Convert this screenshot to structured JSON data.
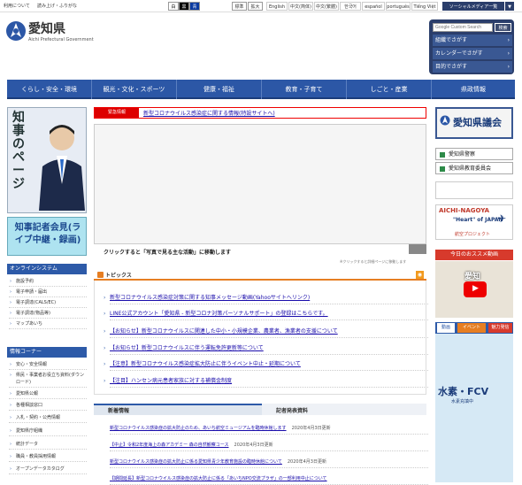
{
  "topbar": {
    "links": [
      "利用について",
      "読み上げ・ふりがな"
    ],
    "contrast": [
      "白",
      "黒",
      "青"
    ],
    "size": [
      "標準",
      "拡大"
    ],
    "langs": [
      "English",
      "中文(简体)",
      "中文(繁體)",
      "한국어",
      "español",
      "português",
      "Tiếng Việt"
    ],
    "sns": "ソーシャルメディア一覧"
  },
  "header": {
    "title": "愛知県",
    "subtitle": "Aichi Prefectural Government"
  },
  "search": {
    "placeholder": "Google Custom Search",
    "button": "検索",
    "items": [
      "組織でさがす",
      "カレンダーでさがす",
      "目的でさがす"
    ]
  },
  "nav": [
    "くらし・安全・環境",
    "観光・文化・スポーツ",
    "健康・福祉",
    "教育・子育て",
    "しごと・産業",
    "県政情報"
  ],
  "left": {
    "governor": "知事のページ",
    "press": "知事記者会見(ライブ中継・録画)",
    "online_head": "オンラインシステム",
    "online": [
      "施設予約",
      "電子申請・届出",
      "電子調達(CALS/EC)",
      "電子調達(物品等)",
      "マップあいち"
    ],
    "info_head": "情報コーナー",
    "info": [
      "安心・安全情報",
      "県民・事業者お役立ち資料(ダウンロード)",
      "愛知県公報",
      "各種相談窓口",
      "入札・契約・公売情報",
      "愛知県庁組織",
      "統計データ",
      "職員・教員採用情報",
      "オープンデータカタログ"
    ]
  },
  "emergency": {
    "label": "緊急情報",
    "text": "新型コロナウイルス感染症に関する情報(特設サイトへ)"
  },
  "slide": {
    "caption": "クリックすると「写真で見る主な活動」に移動します",
    "note": "※クリックすると詳細ページに移動します"
  },
  "topics": {
    "title": "トピックス",
    "items": [
      "新型コロナウイルス感染症対策に関する知事メッセージ動画(Yahooサイトへリンク)",
      "LINE公式アカウント「愛知県 - 新型コロナ対策パーソナルサポート」の登録はこちらです。",
      "【お知らせ】新型コロナウイルスに関連した中小・小規模企業、農業者、漁業者の支援について",
      "【お知らせ】新型コロナウイルスに伴う運転免許更新等について",
      "【注意】新型コロナウイルス感染症拡大防止に伴うイベント中止・延期について",
      "【注目】ハンセン病元患者家族に対する補償金制度"
    ]
  },
  "news": {
    "tab1": "新着情報",
    "tab2": "記者発表資料",
    "items": [
      {
        "text": "新型コロナウイルス感染症の拡大防止のため、あいち航空ミュージアムを臨時休館します",
        "date": "2020年4月3日更新"
      },
      {
        "text": "【中止】令和2年度海上の森アカデミー 森の自然観察コース",
        "date": "2020年4月3日更新"
      },
      {
        "text": "新型コロナウイルス感染症の拡大防止に係る愛知県青少年教育施設の臨時休館について",
        "date": "2020年4月3日更新"
      },
      {
        "text": "【期間延長】新型コロナウイルス感染症の拡大防止に係る「あいちNPO交流プラザ」の一部利用中止について",
        "date": ""
      }
    ]
  },
  "right": {
    "assembly": "愛知県議会",
    "police": "愛知県警察",
    "education": "愛知県教育委員会",
    "aichi": "AICHI-NAGOYA",
    "aichi_sub": "\"Heart\" of JAPAN",
    "project": "航空プロジェクト",
    "reco": "今日のおススメ動画",
    "video_title": "愛知",
    "vtabs": [
      "動画",
      "イベント",
      "魅力発信"
    ],
    "hydro": "水素・FCV",
    "hydro_sub": "水素充填中"
  }
}
